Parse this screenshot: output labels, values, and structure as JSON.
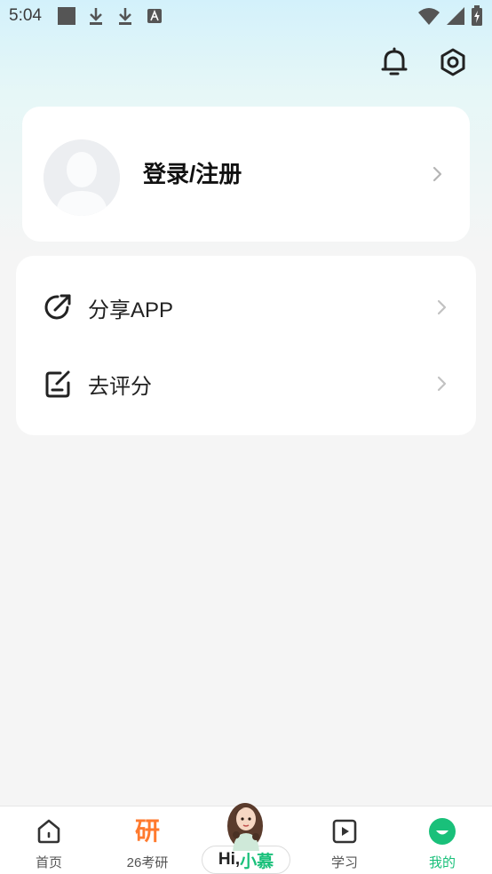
{
  "status_bar": {
    "time": "5:04",
    "left_icons": [
      "square-notification-icon",
      "download-icon",
      "download-icon",
      "text-notification-icon"
    ],
    "right_icons": [
      "wifi-icon",
      "signal-icon",
      "battery-icon"
    ]
  },
  "header": {
    "icons": [
      "bell-icon",
      "settings-icon"
    ]
  },
  "profile": {
    "login_label": "登录/注册",
    "avatar_icon": "default-avatar-icon"
  },
  "menu": {
    "items": [
      {
        "label": "分享APP",
        "icon": "share-icon"
      },
      {
        "label": "去评分",
        "icon": "rate-icon"
      }
    ]
  },
  "bottom_nav": {
    "items": [
      {
        "label": "首页",
        "icon": "home-icon"
      },
      {
        "label": "26考研",
        "icon": "yan-icon",
        "glyph": "研"
      },
      {
        "label": "学习",
        "icon": "play-icon"
      },
      {
        "label": "我的",
        "icon": "profile-smile-icon",
        "active": true
      }
    ],
    "center": {
      "hi": "Hi,",
      "name": "小慕"
    }
  },
  "colors": {
    "accent_green": "#19c07a",
    "accent_orange": "#ff7a2e",
    "background": "#f5f5f5"
  }
}
